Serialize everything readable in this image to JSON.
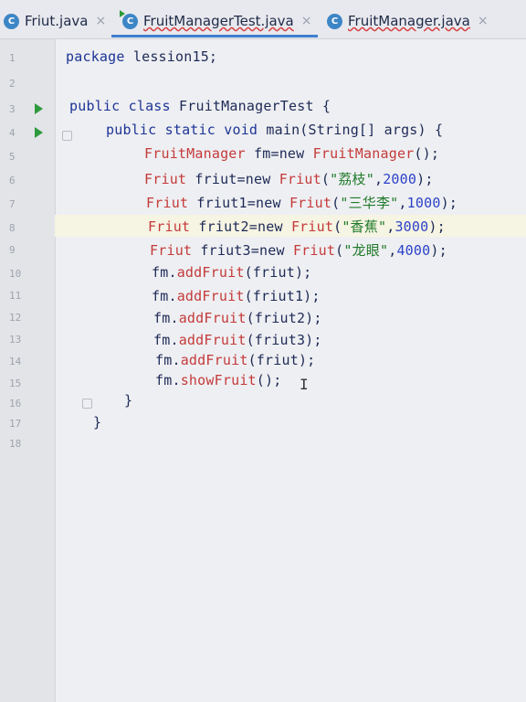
{
  "tabs": [
    {
      "label": "Friut.java",
      "icon": "class-icon",
      "active": false
    },
    {
      "label": "FruitManagerTest.java",
      "icon": "class-icon",
      "active": true
    },
    {
      "label": "FruitManager.java",
      "icon": "class-icon",
      "active": false
    }
  ],
  "line_numbers": [
    "1",
    "2",
    "3",
    "4",
    "5",
    "6",
    "7",
    "8",
    "9",
    "10",
    "11",
    "12",
    "13",
    "14",
    "15",
    "16",
    "17",
    "18"
  ],
  "code": {
    "l1": {
      "kw": "package",
      "rest": " lession15;"
    },
    "l3": {
      "kw": "public class",
      "rest": " FruitManagerTest {"
    },
    "l4": {
      "kw": "public static void",
      "rest": " main(String[] args) {"
    },
    "l5": {
      "cls": "FruitManager",
      "a": " fm=new ",
      "cls2": "FruitManager",
      "b": "();"
    },
    "l6": {
      "cls": "Friut",
      "a": " friut=new ",
      "cls2": "Friut",
      "b": "(",
      "str": "\"荔枝\"",
      "c": ",",
      "num": "2000",
      "d": ");"
    },
    "l7": {
      "cls": "Friut",
      "a": " friut1=new ",
      "cls2": "Friut",
      "b": "(",
      "str": "\"三华李\"",
      "c": ",",
      "num": "1000",
      "d": ");"
    },
    "l8": {
      "cls": "Friut",
      "a": " friut2=new ",
      "cls2": "Friut",
      "b": "(",
      "str": "\"香蕉\"",
      "c": ",",
      "num": "3000",
      "d": ");"
    },
    "l9": {
      "cls": "Friut",
      "a": " friut3=new ",
      "cls2": "Friut",
      "b": "(",
      "str": "\"龙眼\"",
      "c": ",",
      "num": "4000",
      "d": ");"
    },
    "l10": {
      "a": "fm.",
      "fn": "addFruit",
      "b": "(friut);"
    },
    "l11": {
      "a": "fm.",
      "fn": "addFruit",
      "b": "(friut1);"
    },
    "l12": {
      "a": "fm.",
      "fn": "addFruit",
      "b": "(friut2);"
    },
    "l13": {
      "a": "fm.",
      "fn": "addFruit",
      "b": "(friut3);"
    },
    "l14": {
      "a": "fm.",
      "fn": "addFruit",
      "b": "(friut);"
    },
    "l15": {
      "a": "fm.",
      "fn": "showFruit",
      "b": "();"
    },
    "l16": {
      "a": "}"
    },
    "l17": {
      "a": "}"
    }
  },
  "cursor_glyph": "I"
}
